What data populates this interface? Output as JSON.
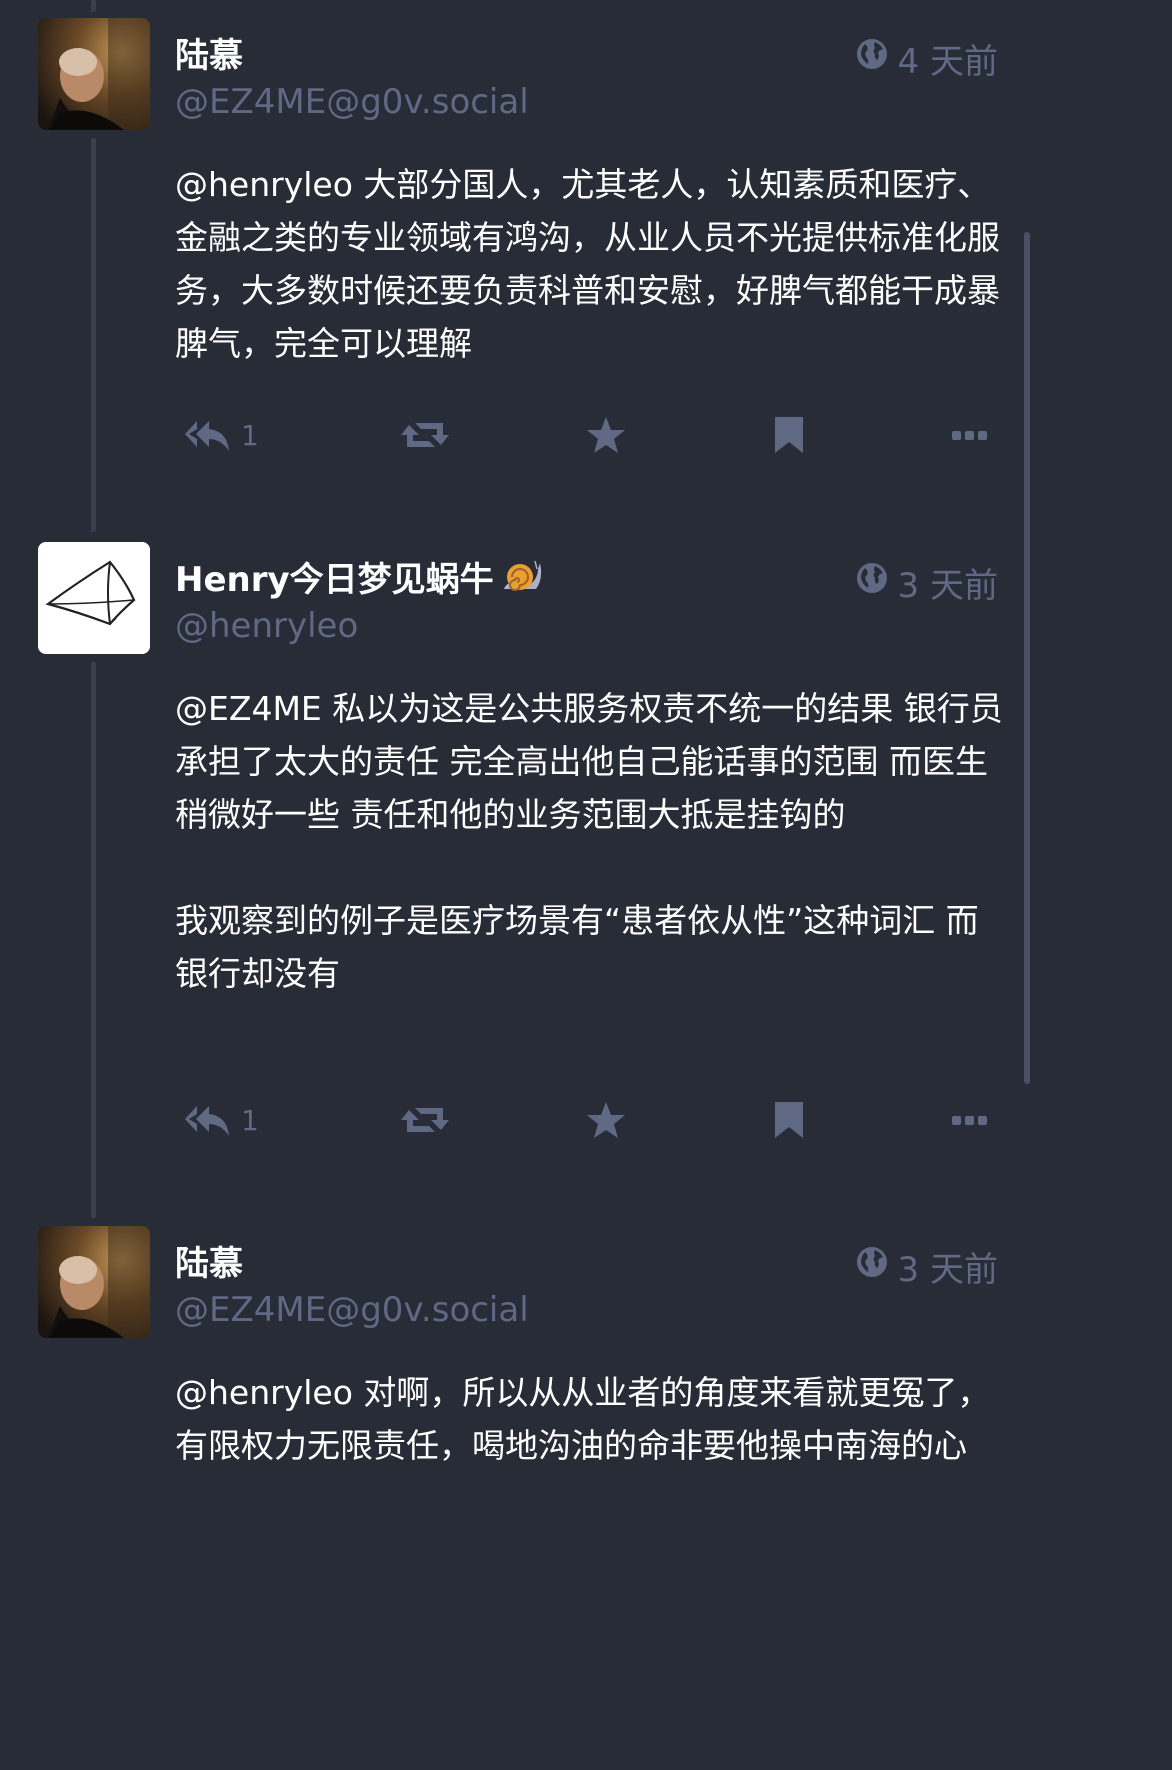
{
  "colors": {
    "background": "#282c37",
    "text": "#ffffff",
    "muted": "#606984",
    "thread_line": "#393f4f"
  },
  "statuses": [
    {
      "display_name": "陆慕",
      "handle": "@EZ4ME@g0v.social",
      "time": "4 天前",
      "visibility_icon": "globe-icon",
      "avatar": "photo-portrait",
      "paragraphs": [
        "@henryleo 大部分国人，尤其老人，认知素质和医疗、金融之类的专业领域有鸿沟，从业人员不光提供标准化服务，大多数时候还要负责科普和安慰，好脾气都能干成暴脾气，完全可以理解"
      ],
      "reply_count": "1"
    },
    {
      "display_name": "Henry今日梦见蜗牛",
      "name_emoji": "snail-icon",
      "handle": "@henryleo",
      "time": "3 天前",
      "visibility_icon": "globe-icon",
      "avatar": "line-drawing",
      "paragraphs": [
        "@EZ4ME 私以为这是公共服务权责不统一的结果 银行员承担了太大的责任 完全高出他自己能话事的范围 而医生稍微好一些 责任和他的业务范围大抵是挂钩的",
        "我观察到的例子是医疗场景有“患者依从性”这种词汇 而银行却没有"
      ],
      "reply_count": "1"
    },
    {
      "display_name": "陆慕",
      "handle": "@EZ4ME@g0v.social",
      "time": "3 天前",
      "visibility_icon": "globe-icon",
      "avatar": "photo-portrait",
      "paragraphs": [
        "@henryleo 对啊，所以从从业者的角度来看就更冤了，有限权力无限责任，喝地沟油的命非要他操中南海的心"
      ]
    }
  ]
}
